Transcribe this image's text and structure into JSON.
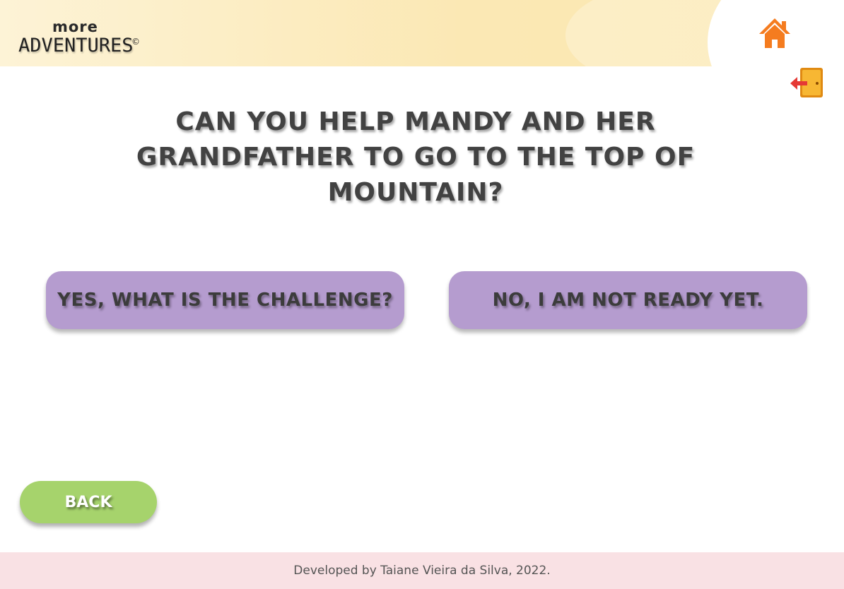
{
  "header": {
    "logo": {
      "top_text": "more",
      "main_text": "ADVENTURES",
      "mark": "©"
    },
    "home_icon": "home-icon",
    "exit_icon": "exit-door-icon"
  },
  "main": {
    "question": "CAN YOU HELP MANDY AND HER GRANDFATHER TO GO TO THE TOP OF MOUNTAIN?",
    "choices": [
      {
        "label": "YES, WHAT IS THE CHALLENGE?"
      },
      {
        "label": "NO, I AM NOT READY YET."
      }
    ],
    "back_label": "BACK"
  },
  "footer": {
    "credit": "Developed by Taiane Vieira da Silva, 2022."
  },
  "colors": {
    "header_bg": "#fbe8b4",
    "choice_bg": "#b59ccf",
    "back_bg": "#a6d36c",
    "footer_bg": "#f9e1e4",
    "home_icon": "#f57c1f",
    "door": "#f5a623",
    "arrow": "#e53935"
  }
}
